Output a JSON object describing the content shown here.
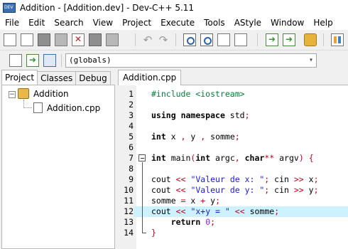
{
  "window": {
    "title": "Addition - [Addition.dev] - Dev-C++ 5.11"
  },
  "menu": [
    "File",
    "Edit",
    "Search",
    "View",
    "Project",
    "Execute",
    "Tools",
    "AStyle",
    "Window",
    "Help"
  ],
  "scope_combo": {
    "value": "(globals)"
  },
  "left_tabs": [
    {
      "label": "Project",
      "active": true
    },
    {
      "label": "Classes",
      "active": false
    },
    {
      "label": "Debug",
      "active": false
    }
  ],
  "project_tree": {
    "root": "Addition",
    "files": [
      "Addition.cpp"
    ]
  },
  "editor": {
    "tab_label": "Addition.cpp",
    "highlighted_line": 12,
    "lines": [
      {
        "n": "1",
        "text": "#include <iostream>"
      },
      {
        "n": "2",
        "text": ""
      },
      {
        "n": "3",
        "text": "using namespace std;"
      },
      {
        "n": "4",
        "text": ""
      },
      {
        "n": "5",
        "text": "int x , y , somme;"
      },
      {
        "n": "6",
        "text": ""
      },
      {
        "n": "7",
        "text": "int main(int argc, char** argv) {"
      },
      {
        "n": "8",
        "text": ""
      },
      {
        "n": "9",
        "text": "cout << \"Valeur de x: \"; cin >> x;"
      },
      {
        "n": "10",
        "text": "cout << \"Valeur de y: \"; cin >> y;"
      },
      {
        "n": "11",
        "text": "somme = x + y;"
      },
      {
        "n": "12",
        "text": "cout << \"x+y = \" << somme;"
      },
      {
        "n": "13",
        "text": "    return 0;"
      },
      {
        "n": "14",
        "text": "}"
      }
    ]
  },
  "colors": {
    "keyword": "#000000",
    "preprocessor": "#00803c",
    "string": "#1a1ad6",
    "operator": "#c0001a",
    "number": "#8a1fd6",
    "current_line": "#ccf2ff"
  }
}
